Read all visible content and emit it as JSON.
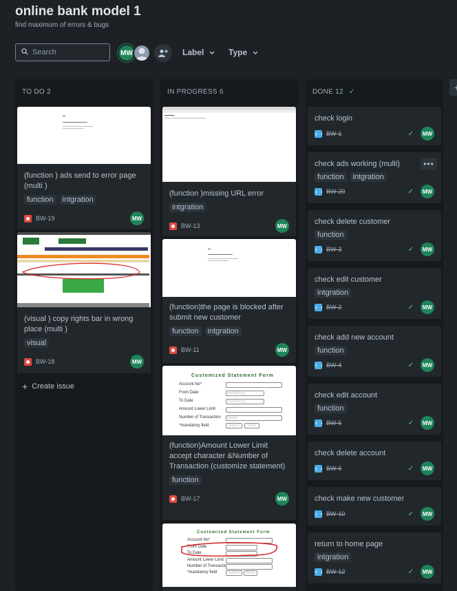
{
  "header": {
    "title": "online bank model 1",
    "subtitle": "find maximum of errors & bugs"
  },
  "toolbar": {
    "search_placeholder": "Search",
    "avatar_initials": "MW",
    "label_filter": "Label",
    "type_filter": "Type"
  },
  "columns": {
    "todo": {
      "title": "TO DO 2",
      "create_issue": "Create issue",
      "cards": [
        {
          "title": "(function ) ads send to error page (multi )",
          "tags": [
            "function",
            "intgration"
          ],
          "key": "BW-19"
        },
        {
          "title": "(visual ) copy rights bar in wrong place (multi )",
          "tags": [
            "visual"
          ],
          "key": "BW-18"
        }
      ]
    },
    "progress": {
      "title": "IN PROGRESS 6",
      "cards": [
        {
          "title": "(function )missing URL error",
          "tags": [
            "intgration"
          ],
          "key": "BW-13"
        },
        {
          "title": "(function)the page is blocked after submit new customer",
          "tags": [
            "function",
            "intgration"
          ],
          "key": "BW-11"
        },
        {
          "title": "(function)Amount Lower Limit accept character &Number of Transaction (customize statement)",
          "tags": [
            "function"
          ],
          "key": "BW-17"
        }
      ]
    },
    "done": {
      "title": "DONE 12",
      "cards": [
        {
          "title": "check login",
          "tags": [],
          "key": "BW-1"
        },
        {
          "title": "check ads working (multi)",
          "tags": [
            "function",
            "intgration"
          ],
          "key": "BW-20"
        },
        {
          "title": "check delete customer",
          "tags": [
            "function"
          ],
          "key": "BW-3"
        },
        {
          "title": "check edit customer",
          "tags": [
            "intgration"
          ],
          "key": "BW-2"
        },
        {
          "title": "check add new account",
          "tags": [
            "function"
          ],
          "key": "BW-4"
        },
        {
          "title": "check edit account",
          "tags": [
            "function"
          ],
          "key": "BW-5"
        },
        {
          "title": "check delete account",
          "tags": [],
          "key": "BW-6"
        },
        {
          "title": "check make new customer",
          "tags": [],
          "key": "BW-10"
        },
        {
          "title": "return to home page",
          "tags": [
            "intgration"
          ],
          "key": "BW-12"
        }
      ]
    }
  },
  "thumbnails": {
    "form_title": "Customized Statement Form",
    "account_no": "Account No*",
    "from_date": "From Date",
    "to_date": "To Date",
    "amount_lower_limit": "Amount Lower Limit",
    "number_of_transaction": "Number of Transaction",
    "mandatory": "*mandatory field",
    "submit": "Submit",
    "reset": "Reset",
    "date_placeholder": "mm/dd/yyyy",
    "txn_value": "zatona"
  },
  "colors": {
    "background": "#1d2125",
    "column": "#161a1d",
    "card": "#22272b",
    "avatar": "#1f845a",
    "bug": "#e2483d",
    "task": "#4bade8",
    "done_check": "#4bce97"
  }
}
